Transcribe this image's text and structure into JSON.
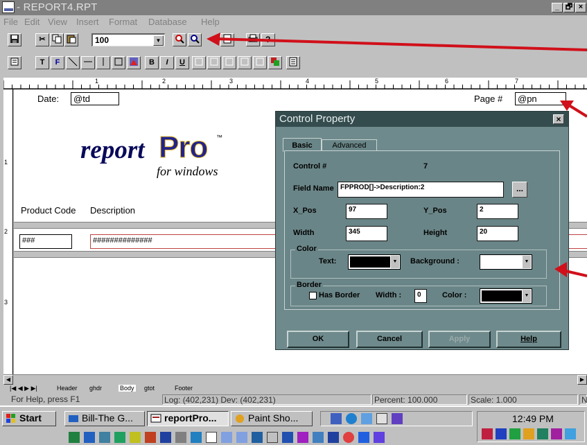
{
  "window": {
    "title": " - REPORT4.RPT",
    "controls": [
      "_",
      "🗗",
      "×"
    ]
  },
  "menu": [
    "File",
    "Edit",
    "View",
    "Insert",
    "Format",
    "Database",
    "Help"
  ],
  "toolbar": {
    "zoom": "100",
    "format_buttons": [
      "T",
      "F",
      "B",
      "I",
      "U"
    ]
  },
  "ruler": {
    "marks": [
      "1",
      "2",
      "3",
      "4",
      "5",
      "6",
      "7"
    ]
  },
  "vruler": {
    "marks": [
      "1",
      "2",
      "3"
    ]
  },
  "report": {
    "date_label": "Date:",
    "date_value": "@td",
    "page_label": "Page #",
    "page_value": "@pn",
    "logo": {
      "word1": "report",
      "word2": "Pro",
      "tm": "™",
      "sub": "for windows"
    },
    "col1": "Product Code",
    "col2": "Description",
    "field1": "###",
    "field2": "##############"
  },
  "dialog": {
    "title": "Control Property",
    "close": "×",
    "tabs": [
      "Basic",
      "Advanced"
    ],
    "control_label": "Control #",
    "control_value": "7",
    "fieldname_label": "Field Name",
    "fieldname_value": "FPPROD[]->Description:2",
    "browse": "...",
    "xpos_label": "X_Pos",
    "xpos_value": "97",
    "ypos_label": "Y_Pos",
    "ypos_value": "2",
    "width_label": "Width",
    "width_value": "345",
    "height_label": "Height",
    "height_value": "20",
    "color_group": "Color",
    "text_label": "Text:",
    "bg_label": "Background :",
    "border_group": "Border",
    "hasborder_label": "Has Border",
    "bwidth_label": "Width :",
    "bwidth_value": "0",
    "bcolor_label": "Color :",
    "buttons": [
      "OK",
      "Cancel",
      "Apply",
      "Help"
    ]
  },
  "bandtabs": [
    "Header",
    "ghdr",
    "Body",
    "gtot",
    "Footer"
  ],
  "status": {
    "help": "For Help, press F1",
    "log": "Log: (402,231) Dev: (402,231)",
    "percent": "Percent: 100.000",
    "scale": "Scale: 1.000",
    "extra": "N"
  },
  "taskbar": {
    "start": "Start",
    "tasks": [
      "Bill-The G...",
      "reportPro...",
      "Paint Sho..."
    ],
    "clock": "12:49 PM"
  },
  "colors": {
    "arrow": "#d0101a",
    "dialog_bg": "#6f8a8c",
    "dialog_title": "#354c4e"
  }
}
